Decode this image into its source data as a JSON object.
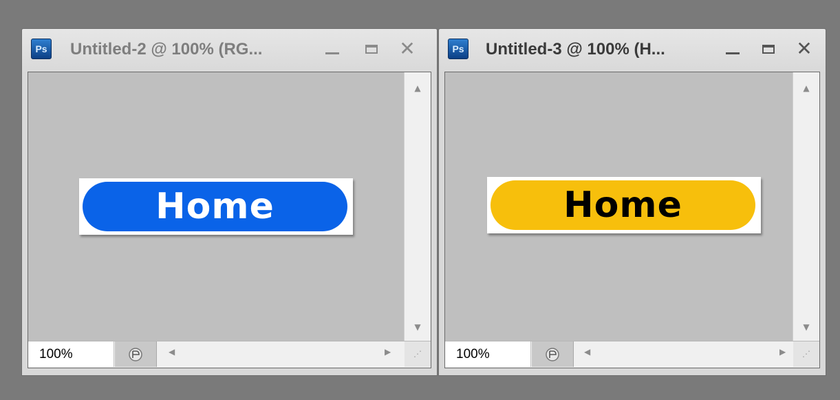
{
  "windows": [
    {
      "app_icon": "Ps",
      "title": "Untitled-2 @ 100% (RG...",
      "zoom": "100%",
      "button": {
        "label": "Home",
        "background": "#0a63e8",
        "text_color": "#ffffff"
      }
    },
    {
      "app_icon": "Ps",
      "title": "Untitled-3 @ 100% (H...",
      "zoom": "100%",
      "button": {
        "label": "Home",
        "background": "#f7bf0c",
        "text_color": "#000000"
      }
    }
  ],
  "controls": {
    "minimize": "—",
    "maximize": "□",
    "close": "✕",
    "scroll_up": "▲",
    "scroll_down": "▼",
    "scroll_left": "◀",
    "scroll_right": "▶"
  },
  "icons": {
    "app": "photoshop-icon",
    "status": "status-menu-icon",
    "grip": "resize-grip-icon"
  }
}
